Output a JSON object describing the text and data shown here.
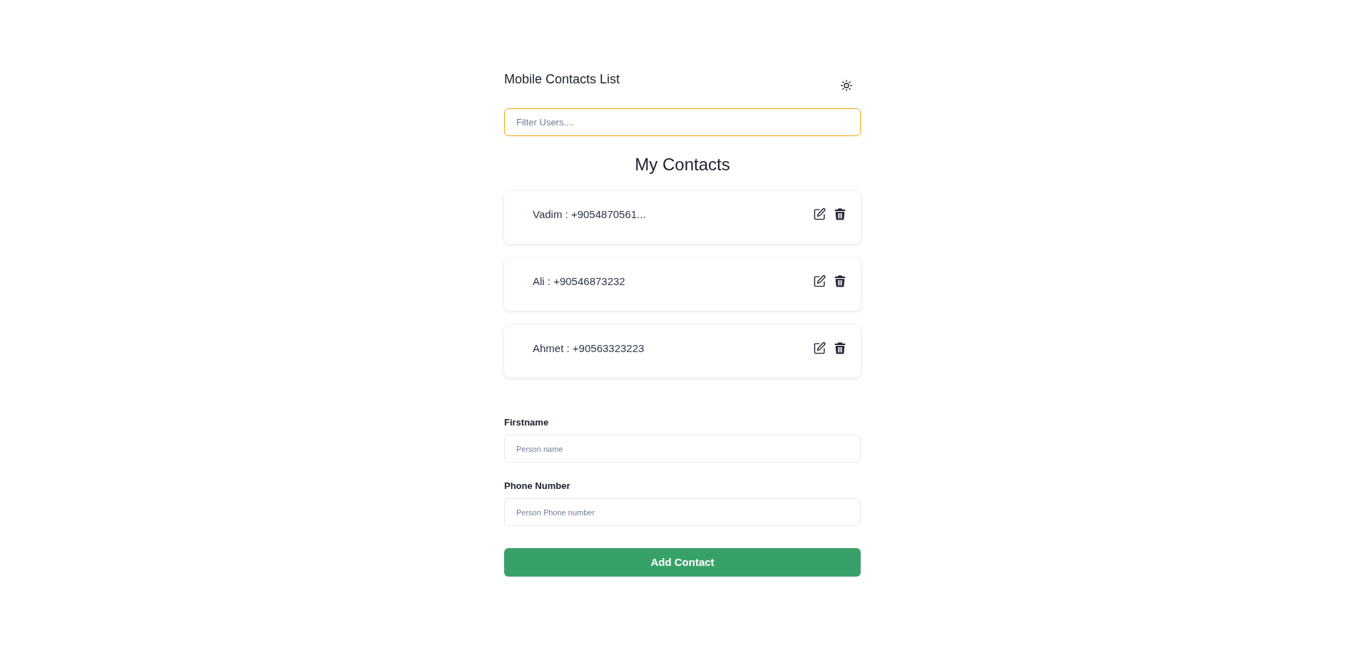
{
  "header": {
    "title": "Mobile Contacts List"
  },
  "filter": {
    "placeholder": "Filter Users....",
    "focused": true
  },
  "contacts_heading": "My Contacts",
  "contacts": [
    {
      "text": "Vadim : +9054870561..."
    },
    {
      "text": "Ali : +90546873232"
    },
    {
      "text": "Ahmet : +90563323223"
    }
  ],
  "form": {
    "fields": [
      {
        "label": "Firstname",
        "placeholder": "Person name"
      },
      {
        "label": "Phone Number",
        "placeholder": "Person Phone number"
      }
    ],
    "submit": "Add Contact"
  }
}
